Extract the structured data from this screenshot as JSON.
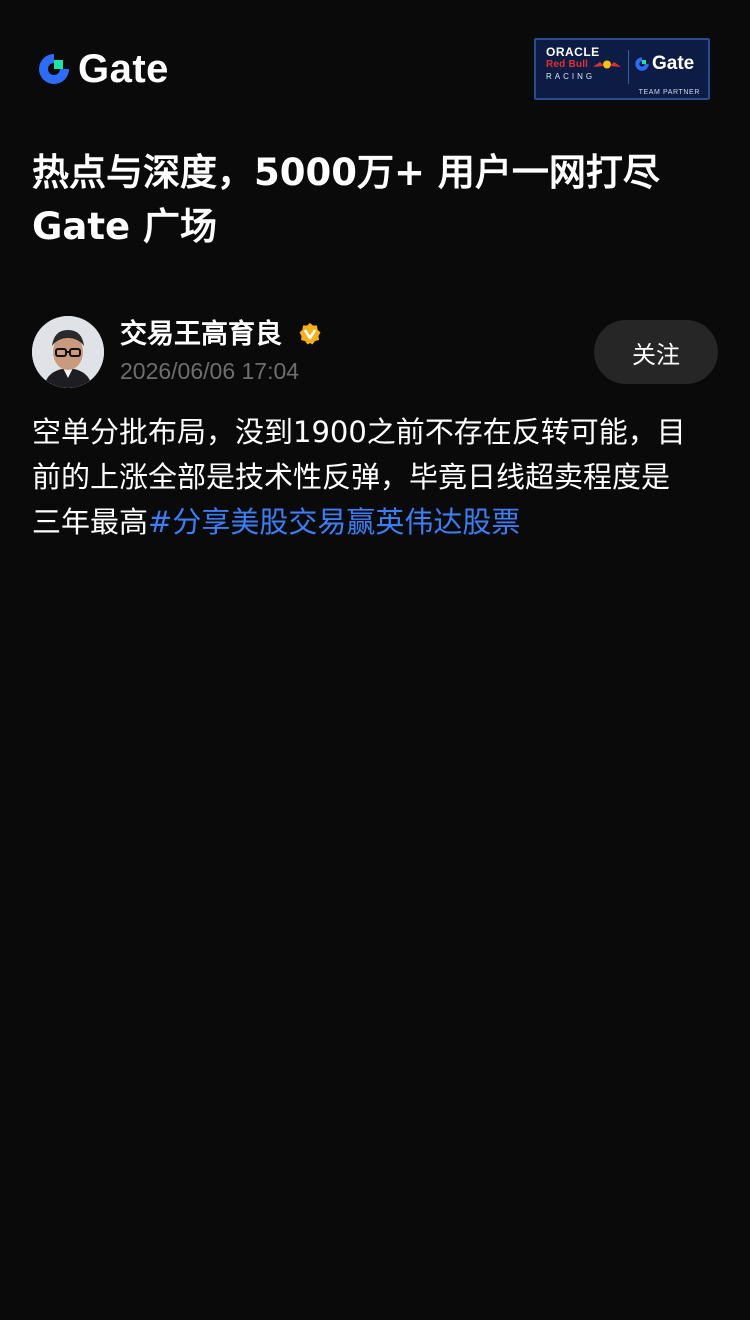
{
  "brand": {
    "logo_text": "Gate",
    "accent_blue": "#2f6cf6",
    "accent_green": "#17e5a0",
    "partner": {
      "oracle": "ORACLE",
      "redbull": "Red Bull",
      "racing": "RACING",
      "gate": "Gate",
      "team": "TEAM PARTNER"
    }
  },
  "headline": {
    "line1": "热点与深度，5000万+ 用户一网打尽",
    "line2": "Gate 广场"
  },
  "post": {
    "author": "交易王高育良",
    "verified_icon": "verified-badge-icon",
    "timestamp": "2026/06/06 17:04",
    "follow_label": "关注",
    "body": {
      "line1": "空单分批布局，没到1900之前不存在反转可能，目",
      "line2": "前的上涨全部是技术性反弹，毕竟日线超卖程度是",
      "line3_prefix": "三年最高",
      "hashtag": "#分享美股交易赢英伟达股票"
    }
  }
}
